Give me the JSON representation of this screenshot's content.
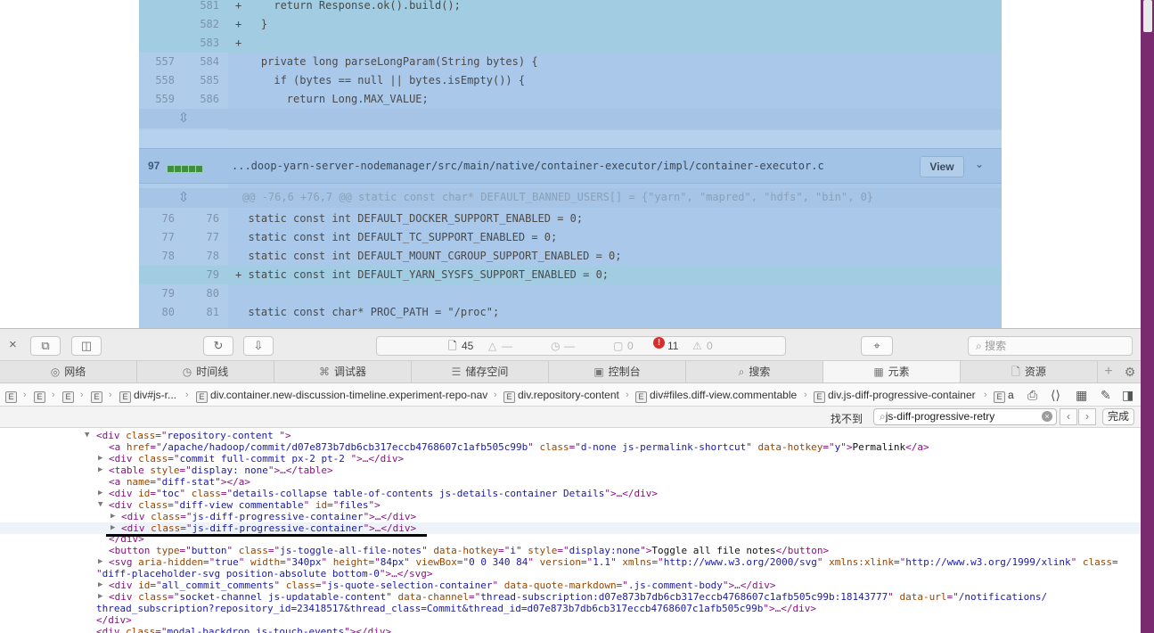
{
  "diff": {
    "top_rows": [
      {
        "old": "",
        "new": "581",
        "text": "+     return Response.ok().build();",
        "add": true
      },
      {
        "old": "",
        "new": "582",
        "text": "+   }",
        "add": true
      },
      {
        "old": "",
        "new": "583",
        "text": "+",
        "add": true
      },
      {
        "old": "557",
        "new": "584",
        "text": "    private long parseLongParam(String bytes) {",
        "add": false
      },
      {
        "old": "558",
        "new": "585",
        "text": "      if (bytes == null || bytes.isEmpty()) {",
        "add": false
      },
      {
        "old": "559",
        "new": "586",
        "text": "        return Long.MAX_VALUE;",
        "add": false
      }
    ],
    "file_header": {
      "number": "97",
      "path": "...doop-yarn-server-nodemanager/src/main/native/container-executor/impl/container-executor.c",
      "view_label": "View"
    },
    "hunk_header": "@@ -76,6 +76,7 @@ static const char* DEFAULT_BANNED_USERS[] = {\"yarn\", \"mapred\", \"hdfs\", \"bin\", 0}",
    "file_rows": [
      {
        "old": "76",
        "new": "76",
        "text": "  static const int DEFAULT_DOCKER_SUPPORT_ENABLED = 0;",
        "add": false
      },
      {
        "old": "77",
        "new": "77",
        "text": "  static const int DEFAULT_TC_SUPPORT_ENABLED = 0;",
        "add": false
      },
      {
        "old": "78",
        "new": "78",
        "text": "  static const int DEFAULT_MOUNT_CGROUP_SUPPORT_ENABLED = 0;",
        "add": false
      },
      {
        "old": "",
        "new": "79",
        "text": "+ static const int DEFAULT_YARN_SYSFS_SUPPORT_ENABLED = 0;",
        "add": true
      },
      {
        "old": "79",
        "new": "80",
        "text": "",
        "add": false
      },
      {
        "old": "80",
        "new": "81",
        "text": "  static const char* PROC_PATH = \"/proc\";",
        "add": false
      }
    ]
  },
  "devtools": {
    "status": {
      "resources": "45",
      "resources_size": "—",
      "time": "—",
      "logs": "0",
      "errors": "11",
      "warnings": "0"
    },
    "search_placeholder": "搜索",
    "tabs": [
      {
        "label": "网络",
        "icon": "network-icon"
      },
      {
        "label": "时间线",
        "icon": "timeline-icon"
      },
      {
        "label": "调试器",
        "icon": "debugger-icon"
      },
      {
        "label": "储存空间",
        "icon": "storage-icon"
      },
      {
        "label": "控制台",
        "icon": "console-icon"
      },
      {
        "label": "搜索",
        "icon": "search-icon"
      },
      {
        "label": "元素",
        "icon": "elements-icon"
      },
      {
        "label": "资源",
        "icon": "resources-icon"
      }
    ],
    "breadcrumbs": [
      "",
      "",
      "",
      "",
      "div#js-r...",
      "div.container.new-discussion-timeline.experiment-repo-nav",
      "div.repository-content",
      "div#files.diff-view.commentable",
      "div.js-diff-progressive-container",
      "a"
    ],
    "find": {
      "not_found": "找不到",
      "query": "js-diff-progressive-retry",
      "done": "完成"
    }
  }
}
